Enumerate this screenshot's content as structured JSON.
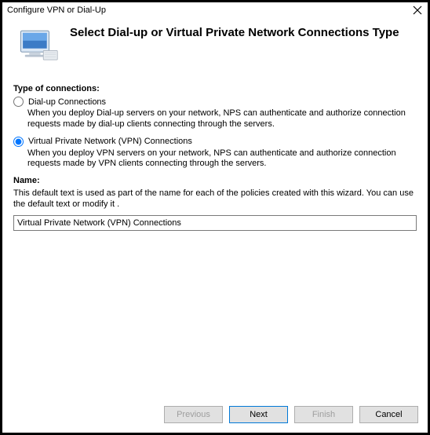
{
  "window": {
    "title": "Configure VPN or Dial-Up"
  },
  "header": {
    "title": "Select Dial-up or Virtual Private Network Connections Type"
  },
  "connections": {
    "legend": "Type of connections:",
    "options": [
      {
        "label": "Dial-up Connections",
        "desc": "When you deploy Dial-up servers on your network, NPS can authenticate and authorize connection requests made by dial-up clients connecting through the servers.",
        "checked": false
      },
      {
        "label": "Virtual Private Network (VPN) Connections",
        "desc": "When you deploy VPN servers on your network, NPS can authenticate and authorize connection requests made by VPN clients connecting through the servers.",
        "checked": true
      }
    ]
  },
  "name_section": {
    "label": "Name:",
    "desc": "This default text is used as part of the name for each of the policies created with this wizard. You can use the default text or modify it .",
    "value": "Virtual Private Network (VPN) Connections"
  },
  "buttons": {
    "previous": "Previous",
    "next": "Next",
    "finish": "Finish",
    "cancel": "Cancel"
  }
}
